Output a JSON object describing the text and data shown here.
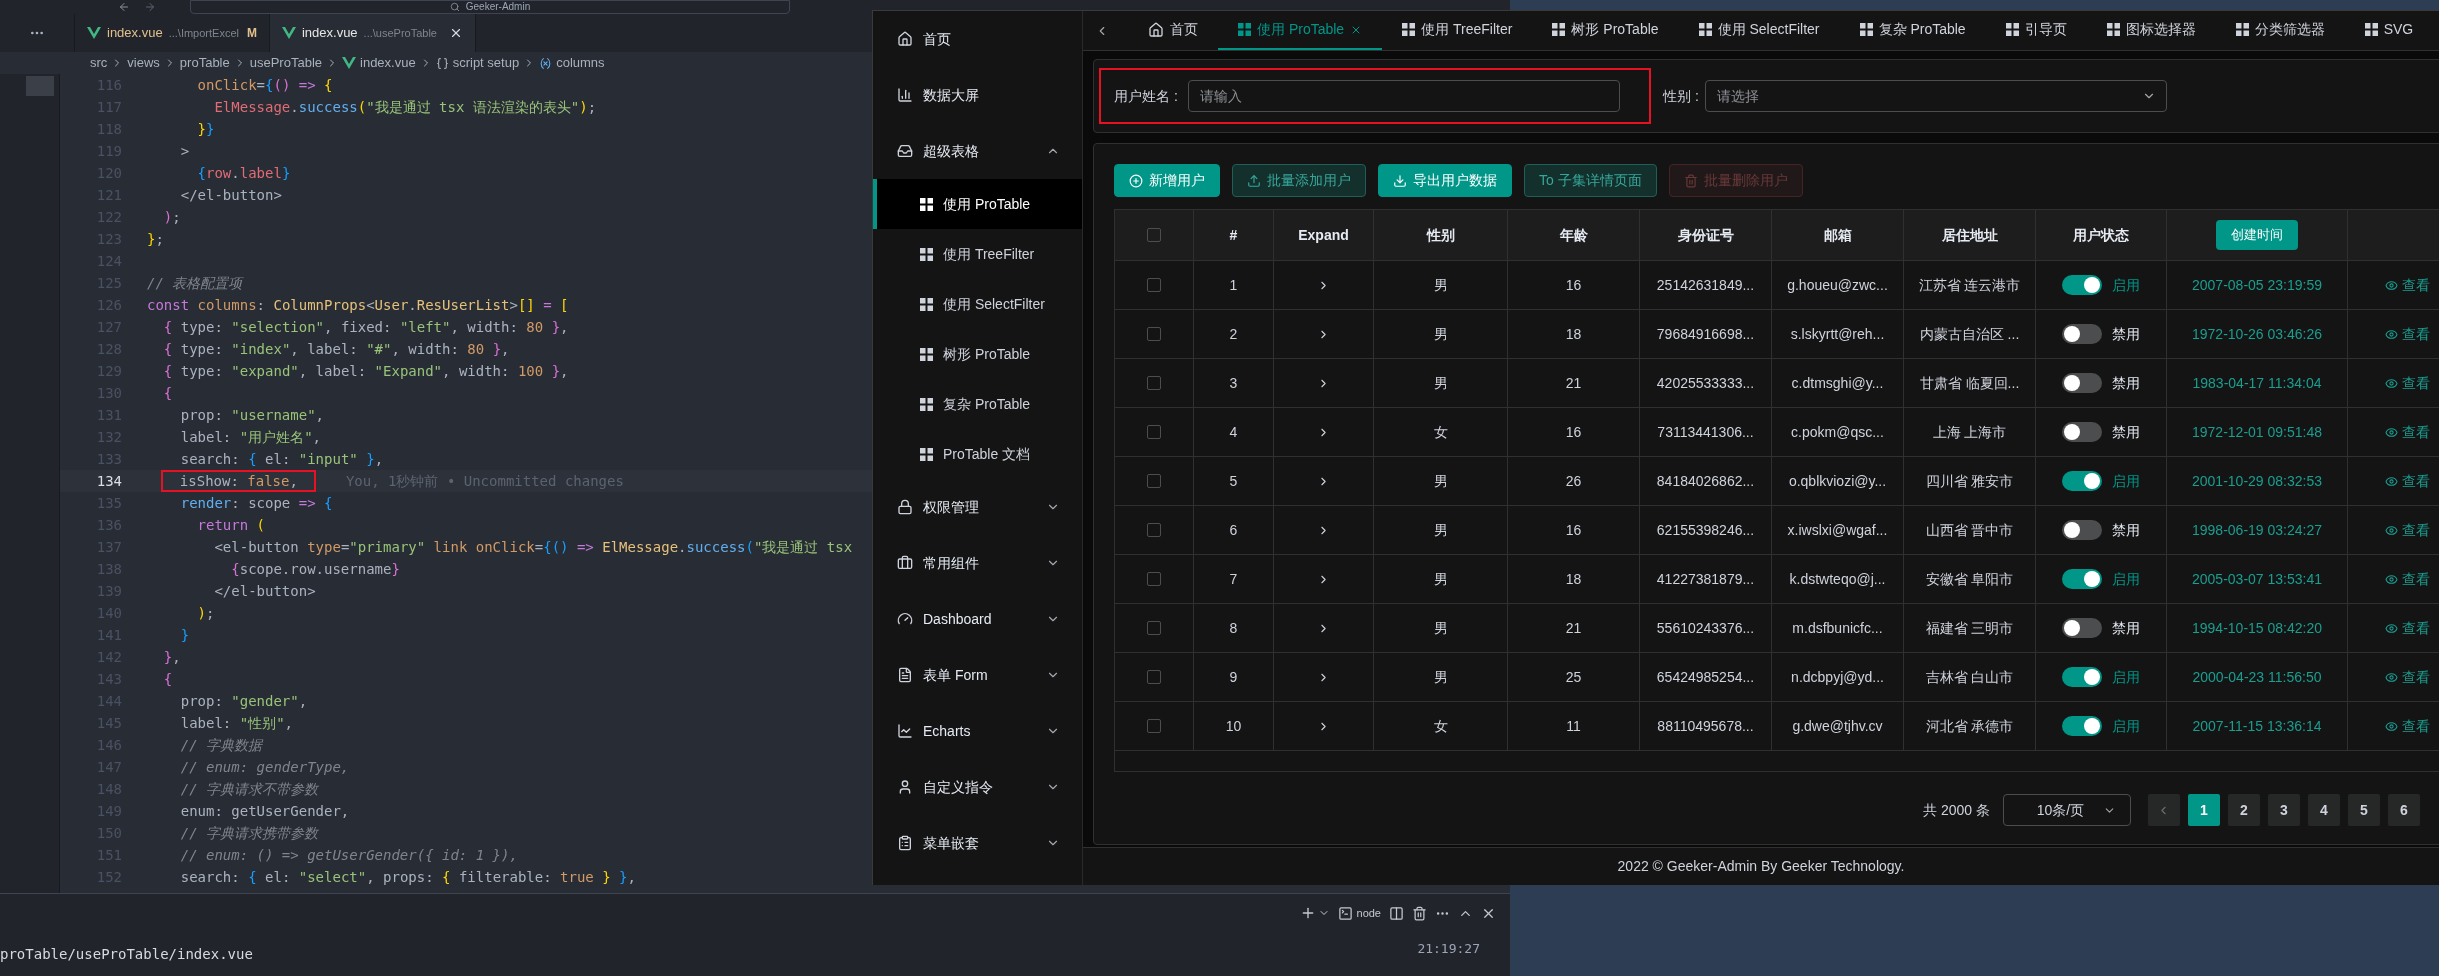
{
  "editor": {
    "window_title": "Geeker-Admin",
    "tabs": [
      {
        "label": "index.vue",
        "path": "...\\ImportExcel",
        "badge": "M",
        "selected": false
      },
      {
        "label": "index.vue",
        "path": "...\\useProTable",
        "selected": true
      }
    ],
    "breadcrumb": [
      {
        "label": "src",
        "kind": "text"
      },
      {
        "label": "views",
        "kind": "text"
      },
      {
        "label": "proTable",
        "kind": "text"
      },
      {
        "label": "useProTable",
        "kind": "text"
      },
      {
        "label": "index.vue",
        "kind": "vue"
      },
      {
        "label": "script setup",
        "kind": "braces"
      },
      {
        "label": "columns",
        "kind": "variable"
      }
    ],
    "lines": [
      {
        "number": "116",
        "current": false,
        "tokens": [
          {
            "kind": "attribute",
            "text": "      onClick"
          },
          {
            "kind": "plain",
            "text": "="
          },
          {
            "kind": "bracket3",
            "text": "{"
          },
          {
            "kind": "bracket2",
            "text": "() "
          },
          {
            "kind": "keyword",
            "text": "=> "
          },
          {
            "kind": "bracket1",
            "text": "{"
          }
        ]
      },
      {
        "number": "117",
        "current": false,
        "tokens": [
          {
            "kind": "variable",
            "text": "        ElMessage"
          },
          {
            "kind": "plain",
            "text": "."
          },
          {
            "kind": "function",
            "text": "success"
          },
          {
            "kind": "bracket1",
            "text": "("
          },
          {
            "kind": "string",
            "text": "\"我是通过 tsx 语法渲染的表头\""
          },
          {
            "kind": "bracket1",
            "text": ")"
          },
          {
            "kind": "plain",
            "text": ";"
          }
        ]
      },
      {
        "number": "118",
        "current": false,
        "tokens": [
          {
            "kind": "bracket1",
            "text": "      }"
          },
          {
            "kind": "bracket3",
            "text": "}"
          }
        ]
      },
      {
        "number": "119",
        "current": false,
        "tokens": [
          {
            "kind": "plain",
            "text": "    >"
          }
        ]
      },
      {
        "number": "120",
        "current": false,
        "tokens": [
          {
            "kind": "bracket3",
            "text": "      {"
          },
          {
            "kind": "variable",
            "text": "row"
          },
          {
            "kind": "plain",
            "text": "."
          },
          {
            "kind": "variable",
            "text": "label"
          },
          {
            "kind": "bracket3",
            "text": "}"
          }
        ]
      },
      {
        "number": "121",
        "current": false,
        "tokens": [
          {
            "kind": "plain",
            "text": "    </el-button>"
          }
        ]
      },
      {
        "number": "122",
        "current": false,
        "tokens": [
          {
            "kind": "bracket2",
            "text": "  )"
          },
          {
            "kind": "plain",
            "text": ";"
          }
        ]
      },
      {
        "number": "123",
        "current": false,
        "tokens": [
          {
            "kind": "bracket1",
            "text": "}"
          },
          {
            "kind": "plain",
            "text": ";"
          }
        ]
      },
      {
        "number": "124",
        "current": false
      },
      {
        "number": "125",
        "current": false,
        "tokens": [
          {
            "kind": "comment",
            "text": "// 表格配置项"
          }
        ]
      },
      {
        "number": "126",
        "current": false,
        "tokens": [
          {
            "kind": "keyword",
            "text": "const "
          },
          {
            "kind": "attribute",
            "text": "columns"
          },
          {
            "kind": "plain",
            "text": ": "
          },
          {
            "kind": "type",
            "text": "ColumnProps"
          },
          {
            "kind": "plain",
            "text": "<"
          },
          {
            "kind": "type",
            "text": "User"
          },
          {
            "kind": "plain",
            "text": "."
          },
          {
            "kind": "type",
            "text": "ResUserList"
          },
          {
            "kind": "plain",
            "text": ">"
          },
          {
            "kind": "bracket1",
            "text": "[] "
          },
          {
            "kind": "keyword",
            "text": "= "
          },
          {
            "kind": "bracket1",
            "text": "["
          }
        ]
      },
      {
        "number": "127",
        "current": false,
        "tokens": [
          {
            "kind": "bracket2",
            "text": "  {"
          },
          {
            "kind": "plain",
            "text": " type: "
          },
          {
            "kind": "string",
            "text": "\"selection\""
          },
          {
            "kind": "plain",
            "text": ", fixed: "
          },
          {
            "kind": "string",
            "text": "\"left\""
          },
          {
            "kind": "plain",
            "text": ", width: "
          },
          {
            "kind": "number",
            "text": "80 "
          },
          {
            "kind": "bracket2",
            "text": "}"
          },
          {
            "kind": "plain",
            "text": ","
          }
        ]
      },
      {
        "number": "128",
        "current": false,
        "tokens": [
          {
            "kind": "bracket2",
            "text": "  {"
          },
          {
            "kind": "plain",
            "text": " type: "
          },
          {
            "kind": "string",
            "text": "\"index\""
          },
          {
            "kind": "plain",
            "text": ", label: "
          },
          {
            "kind": "string",
            "text": "\"#\""
          },
          {
            "kind": "plain",
            "text": ", width: "
          },
          {
            "kind": "number",
            "text": "80 "
          },
          {
            "kind": "bracket2",
            "text": "}"
          },
          {
            "kind": "plain",
            "text": ","
          }
        ]
      },
      {
        "number": "129",
        "current": false,
        "tokens": [
          {
            "kind": "bracket2",
            "text": "  {"
          },
          {
            "kind": "plain",
            "text": " type: "
          },
          {
            "kind": "string",
            "text": "\"expand\""
          },
          {
            "kind": "plain",
            "text": ", label: "
          },
          {
            "kind": "string",
            "text": "\"Expand\""
          },
          {
            "kind": "plain",
            "text": ", width: "
          },
          {
            "kind": "number",
            "text": "100 "
          },
          {
            "kind": "bracket2",
            "text": "}"
          },
          {
            "kind": "plain",
            "text": ","
          }
        ]
      },
      {
        "number": "130",
        "current": false,
        "tokens": [
          {
            "kind": "bracket2",
            "text": "  {"
          }
        ]
      },
      {
        "number": "131",
        "current": false,
        "tokens": [
          {
            "kind": "plain",
            "text": "    prop: "
          },
          {
            "kind": "string",
            "text": "\"username\""
          },
          {
            "kind": "plain",
            "text": ","
          }
        ]
      },
      {
        "number": "132",
        "current": false,
        "tokens": [
          {
            "kind": "plain",
            "text": "    label: "
          },
          {
            "kind": "string",
            "text": "\"用户姓名\""
          },
          {
            "kind": "plain",
            "text": ","
          }
        ]
      },
      {
        "number": "133",
        "current": false,
        "tokens": [
          {
            "kind": "plain",
            "text": "    search: "
          },
          {
            "kind": "bracket3",
            "text": "{"
          },
          {
            "kind": "plain",
            "text": " el: "
          },
          {
            "kind": "string",
            "text": "\"input\" "
          },
          {
            "kind": "bracket3",
            "text": "}"
          },
          {
            "kind": "plain",
            "text": ","
          }
        ]
      },
      {
        "number": "134",
        "current": true,
        "boxed": true,
        "blame": "You, 1秒钟前 • Uncommitted changes",
        "tokens": [
          {
            "kind": "plain",
            "text": "  isShow: "
          },
          {
            "kind": "number",
            "text": "false"
          },
          {
            "kind": "plain",
            "text": ","
          }
        ]
      },
      {
        "number": "135",
        "current": false,
        "tokens": [
          {
            "kind": "function",
            "text": "    render"
          },
          {
            "kind": "plain",
            "text": ": scope "
          },
          {
            "kind": "keyword",
            "text": "=> "
          },
          {
            "kind": "bracket3",
            "text": "{"
          }
        ]
      },
      {
        "number": "136",
        "current": false,
        "tokens": [
          {
            "kind": "keyword",
            "text": "      return "
          },
          {
            "kind": "bracket1",
            "text": "("
          }
        ]
      },
      {
        "number": "137",
        "current": false,
        "tokens": [
          {
            "kind": "plain",
            "text": "        <el-button "
          },
          {
            "kind": "attribute",
            "text": "type"
          },
          {
            "kind": "plain",
            "text": "="
          },
          {
            "kind": "string",
            "text": "\"primary\" "
          },
          {
            "kind": "attribute",
            "text": "link onClick"
          },
          {
            "kind": "plain",
            "text": "="
          },
          {
            "kind": "bracket3",
            "text": "{() "
          },
          {
            "kind": "keyword",
            "text": "=> "
          },
          {
            "kind": "type",
            "text": "ElMessage"
          },
          {
            "kind": "plain",
            "text": "."
          },
          {
            "kind": "function",
            "text": "success"
          },
          {
            "kind": "bracket3",
            "text": "("
          },
          {
            "kind": "string",
            "text": "\"我是通过 tsx"
          }
        ]
      },
      {
        "number": "138",
        "current": false,
        "tokens": [
          {
            "kind": "bracket2",
            "text": "          {"
          },
          {
            "kind": "plain",
            "text": "scope.row.username"
          },
          {
            "kind": "bracket2",
            "text": "}"
          }
        ]
      },
      {
        "number": "139",
        "current": false,
        "tokens": [
          {
            "kind": "plain",
            "text": "        </el-button>"
          }
        ]
      },
      {
        "number": "140",
        "current": false,
        "tokens": [
          {
            "kind": "bracket1",
            "text": "      )"
          },
          {
            "kind": "plain",
            "text": ";"
          }
        ]
      },
      {
        "number": "141",
        "current": false,
        "tokens": [
          {
            "kind": "bracket3",
            "text": "    }"
          }
        ]
      },
      {
        "number": "142",
        "current": false,
        "tokens": [
          {
            "kind": "bracket2",
            "text": "  }"
          },
          {
            "kind": "plain",
            "text": ","
          }
        ]
      },
      {
        "number": "143",
        "current": false,
        "tokens": [
          {
            "kind": "bracket2",
            "text": "  {"
          }
        ]
      },
      {
        "number": "144",
        "current": false,
        "tokens": [
          {
            "kind": "plain",
            "text": "    prop: "
          },
          {
            "kind": "string",
            "text": "\"gender\""
          },
          {
            "kind": "plain",
            "text": ","
          }
        ]
      },
      {
        "number": "145",
        "current": false,
        "tokens": [
          {
            "kind": "plain",
            "text": "    label: "
          },
          {
            "kind": "string",
            "text": "\"性别\""
          },
          {
            "kind": "plain",
            "text": ","
          }
        ]
      },
      {
        "number": "146",
        "current": false,
        "tokens": [
          {
            "kind": "comment",
            "text": "    // 字典数据"
          }
        ]
      },
      {
        "number": "147",
        "current": false,
        "tokens": [
          {
            "kind": "comment",
            "text": "    // enum: genderType,"
          }
        ]
      },
      {
        "number": "148",
        "current": false,
        "tokens": [
          {
            "kind": "comment",
            "text": "    // 字典请求不带参数"
          }
        ]
      },
      {
        "number": "149",
        "current": false,
        "tokens": [
          {
            "kind": "plain",
            "text": "    enum: getUserGender,"
          }
        ]
      },
      {
        "number": "150",
        "current": false,
        "tokens": [
          {
            "kind": "comment",
            "text": "    // 字典请求携带参数"
          }
        ]
      },
      {
        "number": "151",
        "current": false,
        "tokens": [
          {
            "kind": "comment",
            "text": "    // enum: () => getUserGender({ id: 1 }),"
          }
        ]
      },
      {
        "number": "152",
        "current": false,
        "tokens": [
          {
            "kind": "plain",
            "text": "    search: "
          },
          {
            "kind": "bracket3",
            "text": "{"
          },
          {
            "kind": "plain",
            "text": " el: "
          },
          {
            "kind": "string",
            "text": "\"select\""
          },
          {
            "kind": "plain",
            "text": ", props: "
          },
          {
            "kind": "bracket1",
            "text": "{"
          },
          {
            "kind": "plain",
            "text": " filterable: "
          },
          {
            "kind": "number",
            "text": "true "
          },
          {
            "kind": "bracket1",
            "text": "}"
          },
          {
            "kind": "bracket3",
            "text": " }"
          },
          {
            "kind": "plain",
            "text": ","
          }
        ]
      }
    ]
  },
  "terminal": {
    "path": "proTable/useProTable/index.vue",
    "shell": "node",
    "time": "21:19:27"
  },
  "browser": {
    "sidebar": {
      "items": [
        {
          "label": "首页",
          "selected": false
        },
        {
          "label": "数据大屏",
          "selected": false
        },
        {
          "label": "超级表格",
          "selected": false,
          "expanded": true,
          "children": [
            {
              "label": "使用 ProTable",
              "selected": true
            },
            {
              "label": "使用 TreeFilter",
              "selected": false
            },
            {
              "label": "使用 SelectFilter",
              "selected": false
            },
            {
              "label": "树形 ProTable",
              "selected": false
            },
            {
              "label": "复杂 ProTable",
              "selected": false
            },
            {
              "label": "ProTable 文档",
              "selected": false
            }
          ]
        },
        {
          "label": "权限管理",
          "selected": false,
          "expanded": false
        },
        {
          "label": "常用组件",
          "selected": false,
          "expanded": false
        },
        {
          "label": "Dashboard",
          "selected": false,
          "expanded": false
        },
        {
          "label": "表单 Form",
          "selected": false,
          "expanded": false
        },
        {
          "label": "Echarts",
          "selected": false,
          "expanded": false
        },
        {
          "label": "自定义指令",
          "selected": false,
          "expanded": false
        },
        {
          "label": "菜单嵌套",
          "selected": false,
          "expanded": false
        }
      ]
    },
    "tabs": [
      {
        "label": "首页",
        "selected": false
      },
      {
        "label": "使用 ProTable",
        "selected": true
      },
      {
        "label": "使用 TreeFilter",
        "selected": false
      },
      {
        "label": "树形 ProTable",
        "selected": false
      },
      {
        "label": "使用 SelectFilter",
        "selected": false
      },
      {
        "label": "复杂 ProTable",
        "selected": false
      },
      {
        "label": "引导页",
        "selected": false
      },
      {
        "label": "图标选择器",
        "selected": false
      },
      {
        "label": "分类筛选器",
        "selected": false
      },
      {
        "label": "SVG",
        "selected": false
      }
    ],
    "search_form": {
      "fields": [
        {
          "label": "用户姓名 :",
          "placeholder": "请输入",
          "kind": "input",
          "highlighted": true
        },
        {
          "label": "性别 :",
          "placeholder": "请选择",
          "kind": "select",
          "highlighted": false
        }
      ]
    },
    "toolbar": {
      "buttons": [
        {
          "label": "新增用户",
          "kind": "primary",
          "disabled": false
        },
        {
          "label": "批量添加用户",
          "kind": "plain",
          "disabled": false
        },
        {
          "label": "导出用户数据",
          "kind": "primary",
          "disabled": false
        },
        {
          "label": "To 子集详情页面",
          "kind": "plain",
          "disabled": false
        },
        {
          "label": "批量删除用户",
          "kind": "danger",
          "disabled": true
        }
      ]
    },
    "table": {
      "columns": [
        {
          "kind": "selection",
          "checked": false
        },
        {
          "kind": "text",
          "label": "#"
        },
        {
          "kind": "text",
          "label": "Expand"
        },
        {
          "kind": "text",
          "label": "性别"
        },
        {
          "kind": "text",
          "label": "年龄"
        },
        {
          "kind": "text",
          "label": "身份证号"
        },
        {
          "kind": "text",
          "label": "邮箱"
        },
        {
          "kind": "text",
          "label": "居住地址"
        },
        {
          "kind": "text",
          "label": "用户状态"
        },
        {
          "kind": "button",
          "label": "创建时间"
        },
        {
          "kind": "blank"
        }
      ],
      "rows": [
        {
          "checked": false,
          "index": "1",
          "gender": "男",
          "age": "16",
          "id_card": "25142631849...",
          "email": "g.houeu@zwc...",
          "address": "江苏省 连云港市",
          "status": {
            "on": true,
            "label": "启用"
          },
          "created": "2007-08-05 23:19:59",
          "action": "查看"
        },
        {
          "checked": false,
          "index": "2",
          "gender": "男",
          "age": "18",
          "id_card": "79684916698...",
          "email": "s.lskyrtt@reh...",
          "address": "内蒙古自治区 ...",
          "status": {
            "on": false,
            "label": "禁用"
          },
          "created": "1972-10-26 03:46:26",
          "action": "查看"
        },
        {
          "checked": false,
          "index": "3",
          "gender": "男",
          "age": "21",
          "id_card": "42025533333...",
          "email": "c.dtmsghi@y...",
          "address": "甘肃省 临夏回...",
          "status": {
            "on": false,
            "label": "禁用"
          },
          "created": "1983-04-17 11:34:04",
          "action": "查看"
        },
        {
          "checked": false,
          "index": "4",
          "gender": "女",
          "age": "16",
          "id_card": "73113441306...",
          "email": "c.pokm@qsc...",
          "address": "上海 上海市",
          "status": {
            "on": false,
            "label": "禁用"
          },
          "created": "1972-12-01 09:51:48",
          "action": "查看"
        },
        {
          "checked": false,
          "index": "5",
          "gender": "男",
          "age": "26",
          "id_card": "84184026862...",
          "email": "o.qblkviozi@y...",
          "address": "四川省 雅安市",
          "status": {
            "on": true,
            "label": "启用"
          },
          "created": "2001-10-29 08:32:53",
          "action": "查看"
        },
        {
          "checked": false,
          "index": "6",
          "gender": "男",
          "age": "16",
          "id_card": "62155398246...",
          "email": "x.iwslxi@wgaf...",
          "address": "山西省 晋中市",
          "status": {
            "on": false,
            "label": "禁用"
          },
          "created": "1998-06-19 03:24:27",
          "action": "查看"
        },
        {
          "checked": false,
          "index": "7",
          "gender": "男",
          "age": "18",
          "id_card": "41227381879...",
          "email": "k.dstwteqo@j...",
          "address": "安徽省 阜阳市",
          "status": {
            "on": true,
            "label": "启用"
          },
          "created": "2005-03-07 13:53:41",
          "action": "查看"
        },
        {
          "checked": false,
          "index": "8",
          "gender": "男",
          "age": "21",
          "id_card": "55610243376...",
          "email": "m.dsfbunicfc...",
          "address": "福建省 三明市",
          "status": {
            "on": false,
            "label": "禁用"
          },
          "created": "1994-10-15 08:42:20",
          "action": "查看"
        },
        {
          "checked": false,
          "index": "9",
          "gender": "男",
          "age": "25",
          "id_card": "65424985254...",
          "email": "n.dcbpyj@yd...",
          "address": "吉林省 白山市",
          "status": {
            "on": true,
            "label": "启用"
          },
          "created": "2000-04-23 11:56:50",
          "action": "查看"
        },
        {
          "checked": false,
          "index": "10",
          "gender": "女",
          "age": "11",
          "id_card": "88110495678...",
          "email": "g.dwe@tjhv.cv",
          "address": "河北省 承德市",
          "status": {
            "on": true,
            "label": "启用"
          },
          "created": "2007-11-15 13:36:14",
          "action": "查看"
        }
      ]
    },
    "pagination": {
      "total": "共 2000 条",
      "page_size": "10条/页",
      "pages": [
        {
          "label": "1",
          "selected": true
        },
        {
          "label": "2",
          "selected": false
        },
        {
          "label": "3",
          "selected": false
        },
        {
          "label": "4",
          "selected": false
        },
        {
          "label": "5",
          "selected": false
        },
        {
          "label": "6",
          "selected": false
        }
      ]
    },
    "footer": "2022 © Geeker-Admin By Geeker Technology."
  }
}
